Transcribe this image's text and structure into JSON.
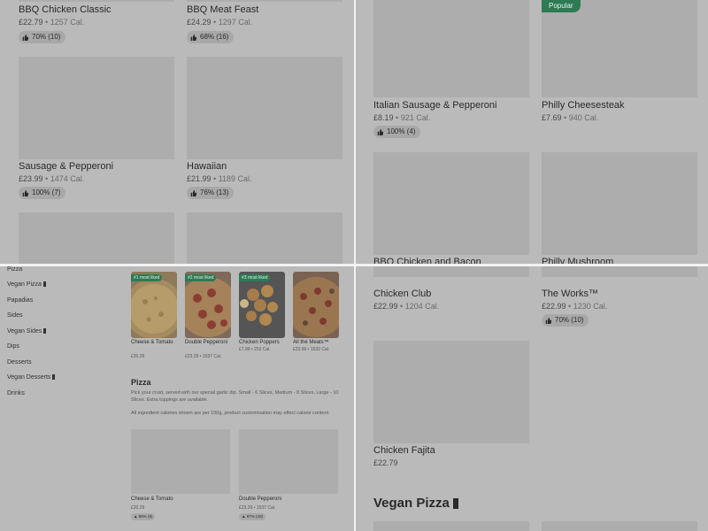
{
  "top_left": {
    "cards": [
      {
        "name": "BBQ Chicken Classic",
        "price": "£22.79",
        "cal": "1257 Cal.",
        "rating": "70% (10)"
      },
      {
        "name": "BBQ Meat Feast",
        "price": "£24.29",
        "cal": "1297 Cal.",
        "rating": "68% (16)"
      },
      {
        "name": "Sausage & Pepperoni",
        "price": "£23.99",
        "cal": "1474 Cal.",
        "rating": "100% (7)"
      },
      {
        "name": "Hawaiian",
        "price": "£21.99",
        "cal": "1189 Cal.",
        "rating": "76% (13)"
      }
    ]
  },
  "top_right": {
    "popular_label": "Popular",
    "cards": [
      {
        "name": "Italian Sausage & Pepperoni",
        "price": "£8.19",
        "cal": "921 Cal.",
        "rating": "100% (4)"
      },
      {
        "name": "Philly  Cheesesteak",
        "price": "£7.69",
        "cal": "940 Cal."
      },
      {
        "name": "BBQ Chicken and Bacon"
      },
      {
        "name": "Philly Mushroom"
      }
    ]
  },
  "bottom_left": {
    "nav": [
      {
        "label": "Pizza",
        "vegan": false
      },
      {
        "label": "Vegan Pizza",
        "vegan": true
      },
      {
        "label": "Papadias",
        "vegan": false
      },
      {
        "label": "Sides",
        "vegan": false
      },
      {
        "label": "Vegan Sides",
        "vegan": true
      },
      {
        "label": "Dips",
        "vegan": false
      },
      {
        "label": "Desserts",
        "vegan": false
      },
      {
        "label": "Vegan Desserts",
        "vegan": true
      },
      {
        "label": "Drinks",
        "vegan": false
      }
    ],
    "most_liked": [
      {
        "badge": "#1 most liked",
        "name": "Cheese & Tomato",
        "price": "£20.29",
        "cal": ""
      },
      {
        "badge": "#2 most liked",
        "name": "Double Pepperoni",
        "price": "£23.29",
        "cal": "1537 Cal."
      },
      {
        "badge": "#3 most liked",
        "name": "Chicken Poppers",
        "price": "£7.99",
        "cal": "253 Cal."
      },
      {
        "badge": "",
        "name": "All the Meats™",
        "price": "£23.99",
        "cal": "1532 Cal."
      }
    ],
    "section_title": "Pizza",
    "section_desc": "Pick your crust, served with our special garlic dip. Small - 6 Slices, Medium - 8 Slices, Large - 10 Slices. Extra toppings are available.",
    "section_note": "All ingredient calories shown are per 100g, product customisation may affect calorie content.",
    "cards": [
      {
        "name": "Cheese & Tomato",
        "price": "£20.29",
        "cal": "",
        "rating": "88% (9)"
      },
      {
        "name": "Double Pepperoni",
        "price": "£23.29",
        "cal": "1537 Cal.",
        "rating": "97% (40)"
      }
    ]
  },
  "bottom_right": {
    "cards": [
      {
        "name": "Chicken Club",
        "price": "£22.99",
        "cal": "1204 Cal."
      },
      {
        "name": "The Works™",
        "price": "£22.99",
        "cal": "1230 Cal.",
        "rating": "70% (10)"
      },
      {
        "name": "Chicken Fajita",
        "price": "£22.79"
      }
    ],
    "section_title": "Vegan Pizza"
  },
  "separator": " • ",
  "colors": {
    "badge_green": "#2e7a55",
    "overlay_gray": "#bdbdbd"
  },
  "icons": {
    "rating": "thumbs-up-icon",
    "vegan": "leaf-icon"
  }
}
